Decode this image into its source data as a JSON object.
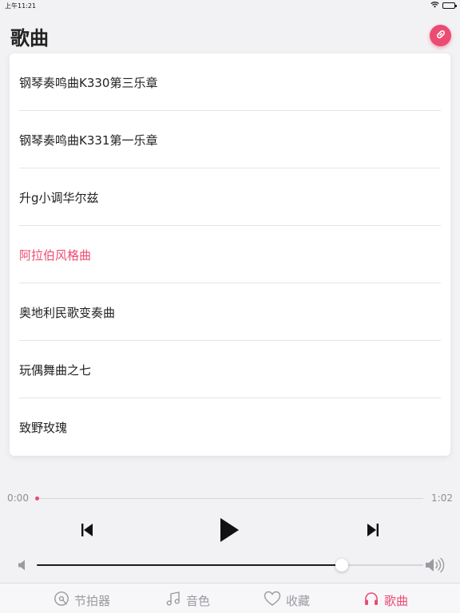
{
  "status_bar": {
    "time": "上午11:21"
  },
  "header": {
    "title": "歌曲"
  },
  "songs": [
    {
      "title": "钢琴奏鸣曲K330第三乐章",
      "active": false
    },
    {
      "title": "钢琴奏鸣曲K331第一乐章",
      "active": false
    },
    {
      "title": "升g小调华尔兹",
      "active": false
    },
    {
      "title": "阿拉伯风格曲",
      "active": true
    },
    {
      "title": "奥地利民歌变奏曲",
      "active": false
    },
    {
      "title": "玩偶舞曲之七",
      "active": false
    },
    {
      "title": "致野玫瑰",
      "active": false
    }
  ],
  "player": {
    "current_time": "0:00",
    "total_time": "1:02",
    "progress": 0.0,
    "volume": 0.79
  },
  "tabs": [
    {
      "label": "节拍器",
      "icon": "metronome-icon",
      "active": false
    },
    {
      "label": "音色",
      "icon": "music-note-icon",
      "active": false
    },
    {
      "label": "收藏",
      "icon": "heart-icon",
      "active": false
    },
    {
      "label": "歌曲",
      "icon": "headphones-icon",
      "active": true
    }
  ],
  "colors": {
    "accent": "#ec4c72",
    "inactive_tab": "#9a9aa0",
    "background": "#f2f2f4"
  }
}
